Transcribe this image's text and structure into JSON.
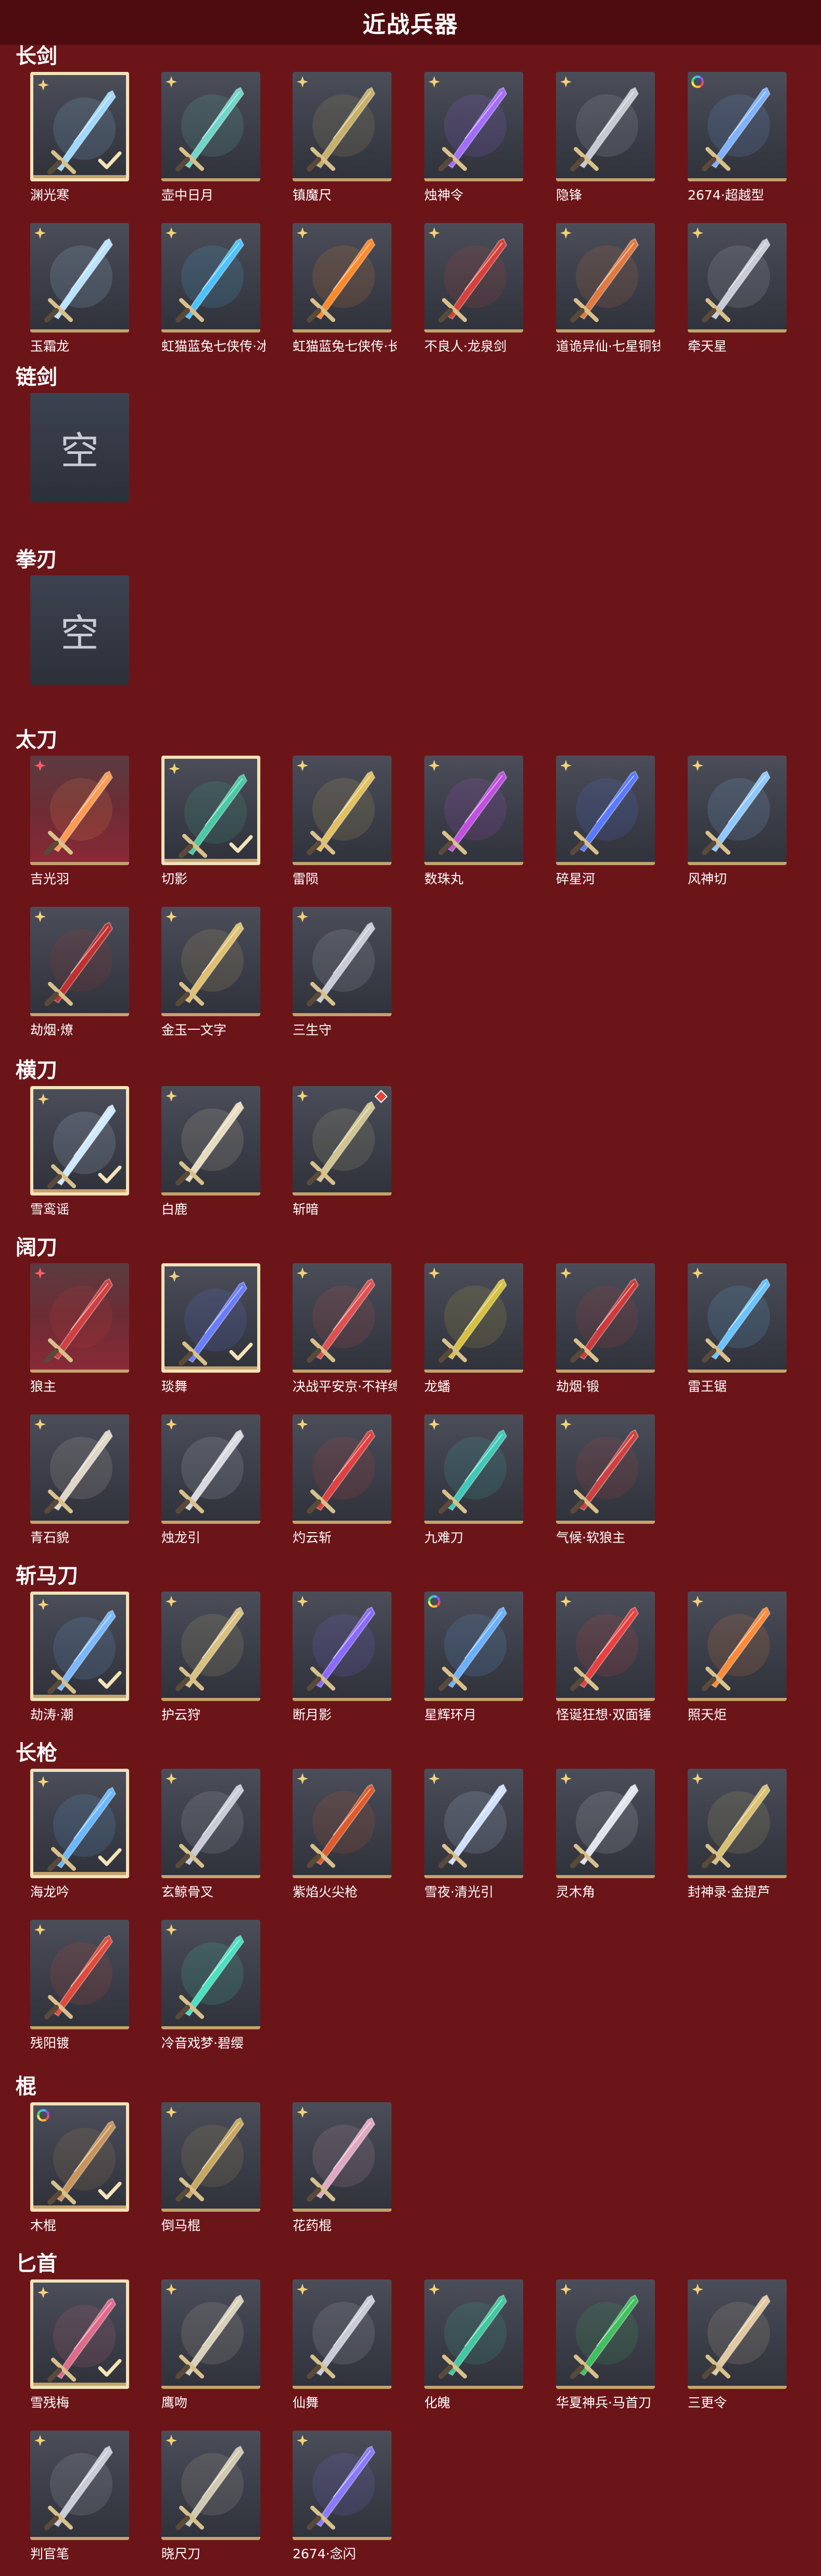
{
  "header": {
    "title": "近战兵器"
  },
  "colors": {
    "background": "#6c1519",
    "header": "#4f0c10",
    "tile": "#3b3e48",
    "rare_tile": "#8a2a36",
    "frame_accent": "#c4a36d",
    "selected_border": "#f3e3b8"
  },
  "empty_label": "空",
  "sections": [
    {
      "title": "长剑",
      "items": [
        {
          "name": "渊光寒",
          "badge": "star-gold",
          "selected": true,
          "color": "#9fd8ff"
        },
        {
          "name": "壶中日月",
          "badge": "star-gold",
          "color": "#6fd6c8"
        },
        {
          "name": "镇魔尺",
          "badge": "star-gold",
          "color": "#c8b06a"
        },
        {
          "name": "烛神令",
          "badge": "star-gold",
          "color": "#a36dff"
        },
        {
          "name": "隐锋",
          "badge": "star-gold",
          "color": "#c6c9d2"
        },
        {
          "name": "2674·超越型",
          "badge": "rainbow",
          "color": "#7fb2ff"
        },
        {
          "name": "玉霜龙",
          "badge": "star-gold",
          "color": "#b9e3ff"
        },
        {
          "name": "虹猫蓝兔七侠传·冰魄...",
          "badge": "star-gold",
          "color": "#4cc3ff"
        },
        {
          "name": "虹猫蓝兔七侠传·长虹...",
          "badge": "star-gold",
          "color": "#ff8a2a"
        },
        {
          "name": "不良人·龙泉剑",
          "badge": "star-gold",
          "color": "#d8403a"
        },
        {
          "name": "道诡异仙·七星铜钱剑",
          "badge": "star-gold",
          "color": "#e07a40"
        },
        {
          "name": "牵天星",
          "badge": "star-gold",
          "color": "#c8ccd6"
        }
      ]
    },
    {
      "title": "链剑",
      "items": [
        {
          "name": "",
          "empty": true
        }
      ]
    },
    {
      "title": "拳刃",
      "items": [
        {
          "name": "",
          "empty": true
        }
      ]
    },
    {
      "title": "太刀",
      "items": [
        {
          "name": "吉光羽",
          "badge": "star-red",
          "rare": true,
          "color": "#ff9a52"
        },
        {
          "name": "切影",
          "badge": "star-gold",
          "selected": true,
          "color": "#49c9a4"
        },
        {
          "name": "雷陨",
          "badge": "star-gold",
          "color": "#e0c060"
        },
        {
          "name": "数珠丸",
          "badge": "star-gold",
          "color": "#c050e0"
        },
        {
          "name": "碎星河",
          "badge": "star-gold",
          "color": "#5a7aff"
        },
        {
          "name": "风神切",
          "badge": "star-gold",
          "color": "#8fc8ff"
        },
        {
          "name": "劫烟·燎",
          "badge": "star-gold",
          "color": "#c03030"
        },
        {
          "name": "金玉一文字",
          "badge": "star-gold",
          "color": "#e0c070"
        },
        {
          "name": "三生守",
          "badge": "star-gold",
          "color": "#c8ccd6"
        }
      ]
    },
    {
      "title": "横刀",
      "items": [
        {
          "name": "雪鸾谣",
          "badge": "star-gold",
          "selected": true,
          "color": "#cfe9ff"
        },
        {
          "name": "白鹿",
          "badge": "star-gold",
          "color": "#e8dcc0"
        },
        {
          "name": "斩暗",
          "badge": "star-gold",
          "corner": "red-diamond",
          "color": "#d0c490"
        }
      ]
    },
    {
      "title": "阔刀",
      "items": [
        {
          "name": "狼主",
          "badge": "star-red",
          "rare": true,
          "color": "#d04040"
        },
        {
          "name": "琰舞",
          "badge": "star-gold",
          "selected": true,
          "color": "#6a7dff"
        },
        {
          "name": "决战平安京·不祥缚刃",
          "badge": "star-gold",
          "color": "#e05050"
        },
        {
          "name": "龙蟠",
          "badge": "star-gold",
          "color": "#d6c040"
        },
        {
          "name": "劫烟·锻",
          "badge": "star-gold",
          "color": "#d03a3a"
        },
        {
          "name": "雷王锯",
          "badge": "star-gold",
          "color": "#6ac4ff"
        },
        {
          "name": "青石貌",
          "badge": "star-gold",
          "color": "#e0d6c8"
        },
        {
          "name": "烛龙引",
          "badge": "star-gold",
          "color": "#d8d8e0"
        },
        {
          "name": "灼云斩",
          "badge": "star-gold",
          "color": "#e04040"
        },
        {
          "name": "九难刀",
          "badge": "star-gold",
          "color": "#40c8b8"
        },
        {
          "name": "气候·软狼主",
          "badge": "star-gold",
          "color": "#d04040"
        }
      ]
    },
    {
      "title": "斩马刀",
      "items": [
        {
          "name": "劫涛·潮",
          "badge": "star-gold",
          "selected": true,
          "color": "#7ab8ff"
        },
        {
          "name": "护云狩",
          "badge": "star-gold",
          "color": "#d8c080"
        },
        {
          "name": "断月影",
          "badge": "star-gold",
          "color": "#8a6aff"
        },
        {
          "name": "星辉环月",
          "badge": "rainbow",
          "color": "#6ab0ff"
        },
        {
          "name": "怪诞狂想·双面锤",
          "badge": "star-gold",
          "color": "#e84040"
        },
        {
          "name": "照天炬",
          "badge": "star-gold",
          "color": "#ff8a3a"
        }
      ]
    },
    {
      "title": "长枪",
      "items": [
        {
          "name": "海龙吟",
          "badge": "star-gold",
          "selected": true,
          "color": "#6ab8ff"
        },
        {
          "name": "玄鲸骨叉",
          "badge": "star-gold",
          "color": "#c8ccd6"
        },
        {
          "name": "紫焰火尖枪",
          "badge": "star-gold",
          "color": "#e05a2a"
        },
        {
          "name": "雪夜·清光引",
          "badge": "star-gold",
          "color": "#cfe0ff"
        },
        {
          "name": "灵木角",
          "badge": "star-gold",
          "color": "#e0e4ec"
        },
        {
          "name": "封神录·金提芦",
          "badge": "star-gold",
          "color": "#d8c070"
        },
        {
          "name": "残阳镀",
          "badge": "star-gold",
          "color": "#e04a3a"
        },
        {
          "name": "冷音戏梦·碧缨",
          "badge": "star-gold",
          "color": "#4ae0c0"
        }
      ]
    },
    {
      "title": "棍",
      "items": [
        {
          "name": "木棍",
          "badge": "rainbow",
          "selected": true,
          "color": "#c8945a"
        },
        {
          "name": "倒马棍",
          "badge": "star-gold",
          "color": "#c8a860"
        },
        {
          "name": "花药棍",
          "badge": "star-gold",
          "color": "#e0a8c0"
        }
      ]
    },
    {
      "title": "匕首",
      "items": [
        {
          "name": "雪残梅",
          "badge": "star-gold",
          "selected": true,
          "color": "#e06a8a"
        },
        {
          "name": "鹰吻",
          "badge": "star-gold",
          "color": "#d8d0b8"
        },
        {
          "name": "仙舞",
          "badge": "star-gold",
          "color": "#c8ccd6"
        },
        {
          "name": "化魄",
          "badge": "star-gold",
          "color": "#40c8a0"
        },
        {
          "name": "华夏神兵·马首刀",
          "badge": "star-gold",
          "color": "#40c060"
        },
        {
          "name": "三更令",
          "badge": "star-gold",
          "color": "#e0c8a0"
        },
        {
          "name": "判官笔",
          "badge": "star-gold",
          "color": "#c8ccd6"
        },
        {
          "name": "晓尺刀",
          "badge": "star-gold",
          "color": "#d0c8b0"
        },
        {
          "name": "2674·念闪",
          "badge": "star-gold",
          "color": "#8a7aff"
        }
      ]
    }
  ]
}
